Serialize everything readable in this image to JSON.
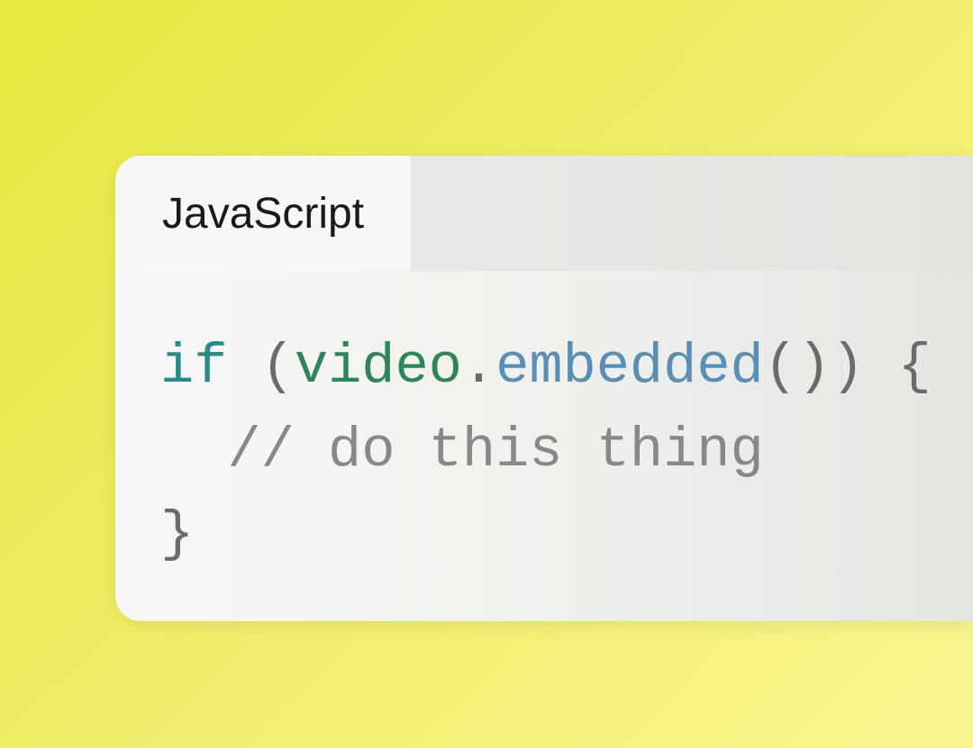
{
  "tab": {
    "label": "JavaScript"
  },
  "code": {
    "line1": {
      "keyword": "if",
      "space1": " ",
      "paren_open": "(",
      "variable": "video",
      "dot": ".",
      "method": "embedded",
      "call": "()",
      "paren_close": ")",
      "space2": " ",
      "brace_open": "{"
    },
    "line2": {
      "indent": "  ",
      "comment": "// do this thing"
    },
    "line3": {
      "brace_close": "}"
    }
  }
}
